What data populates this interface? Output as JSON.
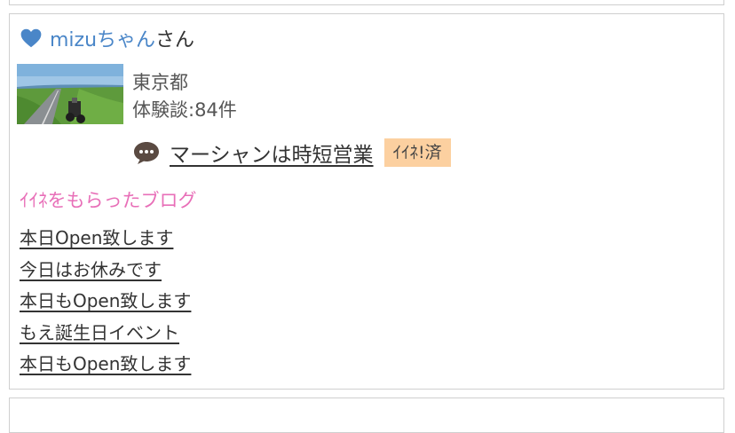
{
  "user": {
    "name": "mizuちゃん",
    "suffix": "さん",
    "location": "東京都",
    "experience_count": "体験談:84件"
  },
  "latest_post": {
    "title": "マーシャンは時短営業",
    "iine_badge": "ｲｲﾈ!済"
  },
  "liked_blogs": {
    "heading": "ｲｲﾈをもらったブログ",
    "items": [
      {
        "title": "本日Open致します"
      },
      {
        "title": "今日はお休みです"
      },
      {
        "title": "本日もOpen致します"
      },
      {
        "title": "もえ誕生日イベント"
      },
      {
        "title": "本日もOpen致します"
      }
    ]
  },
  "colors": {
    "accent_blue": "#4a86c8",
    "pink_heading": "#e86fb8",
    "badge_bg": "#fcd0a0",
    "border": "#cfcfcf"
  },
  "icons": {
    "user_icon": "heart-icon",
    "post_icon": "speech-bubble-icon"
  }
}
